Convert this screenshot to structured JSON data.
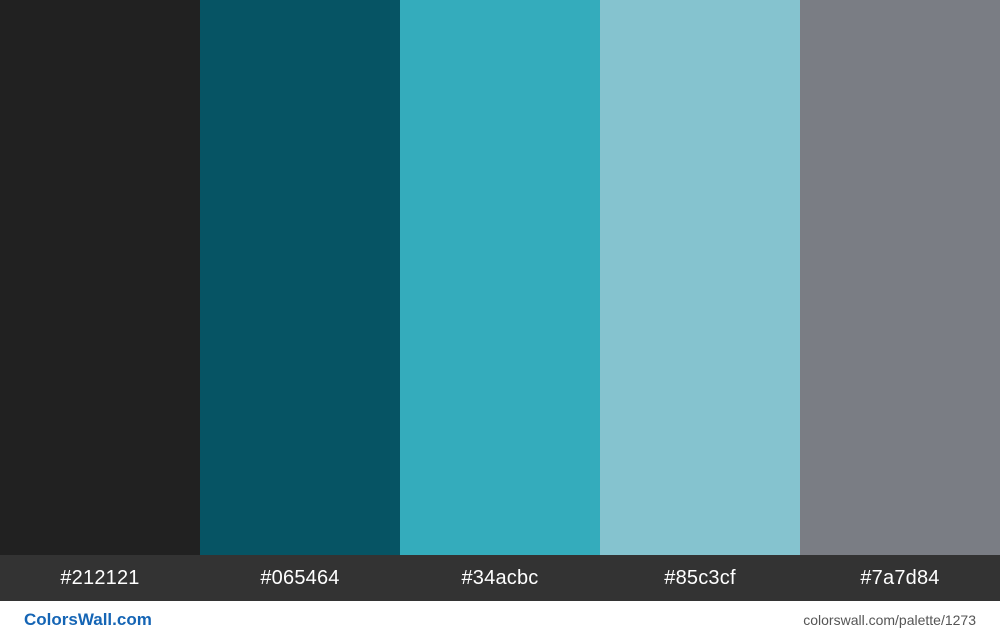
{
  "palette": {
    "swatches": [
      {
        "hex": "#212121",
        "label": "#212121"
      },
      {
        "hex": "#065464",
        "label": "#065464"
      },
      {
        "hex": "#34acbc",
        "label": "#34acbc"
      },
      {
        "hex": "#85c3cf",
        "label": "#85c3cf"
      },
      {
        "hex": "#7a7d84",
        "label": "#7a7d84"
      }
    ]
  },
  "colors": {
    "label_bar_bg": "#333333",
    "brand_color": "#1565b5"
  },
  "footer": {
    "brand": "ColorsWall.com",
    "url": "colorswall.com/palette/1273"
  }
}
